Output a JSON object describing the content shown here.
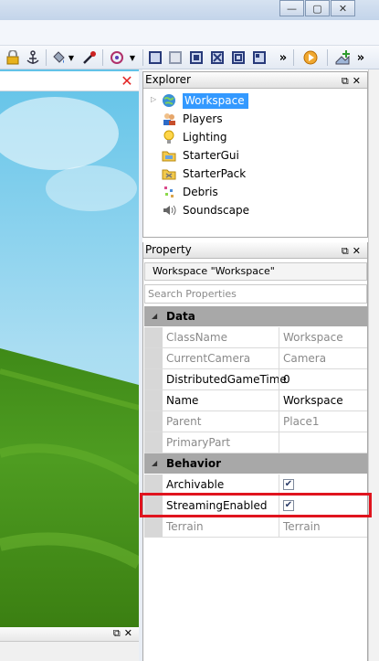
{
  "window_controls": {
    "minimize": "—",
    "restore": "▢",
    "close": "✕"
  },
  "toolbar": {
    "icons": [
      "lock-icon",
      "anchor-icon",
      "paint-bucket-icon",
      "dropdown-arrow-icon",
      "color-picker-icon",
      "group-icon",
      "dropdown-arrow-icon",
      "select-icon",
      "move-icon",
      "scale-icon",
      "rotate-icon",
      "transform-icon",
      "snap-icon"
    ],
    "overflow_1": "»",
    "overflow_2": "»"
  },
  "viewport": {
    "close_icon": "✕"
  },
  "explorer": {
    "title": "Explorer",
    "items": [
      {
        "label": "Workspace",
        "icon": "globe-icon",
        "selected": true
      },
      {
        "label": "Players",
        "icon": "players-icon"
      },
      {
        "label": "Lighting",
        "icon": "lightbulb-icon"
      },
      {
        "label": "StarterGui",
        "icon": "folder-icon"
      },
      {
        "label": "StarterPack",
        "icon": "folder-icon"
      },
      {
        "label": "Debris",
        "icon": "debris-icon"
      },
      {
        "label": "Soundscape",
        "icon": "speaker-icon"
      }
    ]
  },
  "property": {
    "title": "Property",
    "object_label": "Workspace \"Workspace\"",
    "search_placeholder": "Search Properties",
    "categories": [
      {
        "name": "Data",
        "rows": [
          {
            "name": "ClassName",
            "value": "Workspace",
            "readonly": true
          },
          {
            "name": "CurrentCamera",
            "value": "Camera",
            "readonly": true
          },
          {
            "name": "DistributedGameTime",
            "value": "0",
            "readonly": false
          },
          {
            "name": "Name",
            "value": "Workspace",
            "readonly": false
          },
          {
            "name": "Parent",
            "value": "Place1",
            "readonly": true
          },
          {
            "name": "PrimaryPart",
            "value": "",
            "readonly": true
          }
        ]
      },
      {
        "name": "Behavior",
        "rows": [
          {
            "name": "Archivable",
            "value": true,
            "type": "checkbox",
            "readonly": false
          },
          {
            "name": "StreamingEnabled",
            "value": true,
            "type": "checkbox",
            "readonly": false,
            "highlighted": true
          },
          {
            "name": "Terrain",
            "value": "Terrain",
            "readonly": true
          }
        ]
      }
    ]
  },
  "colors": {
    "selection": "#3399ff",
    "category_bg": "#a8a8a8",
    "highlight_box": "#e0141e"
  }
}
